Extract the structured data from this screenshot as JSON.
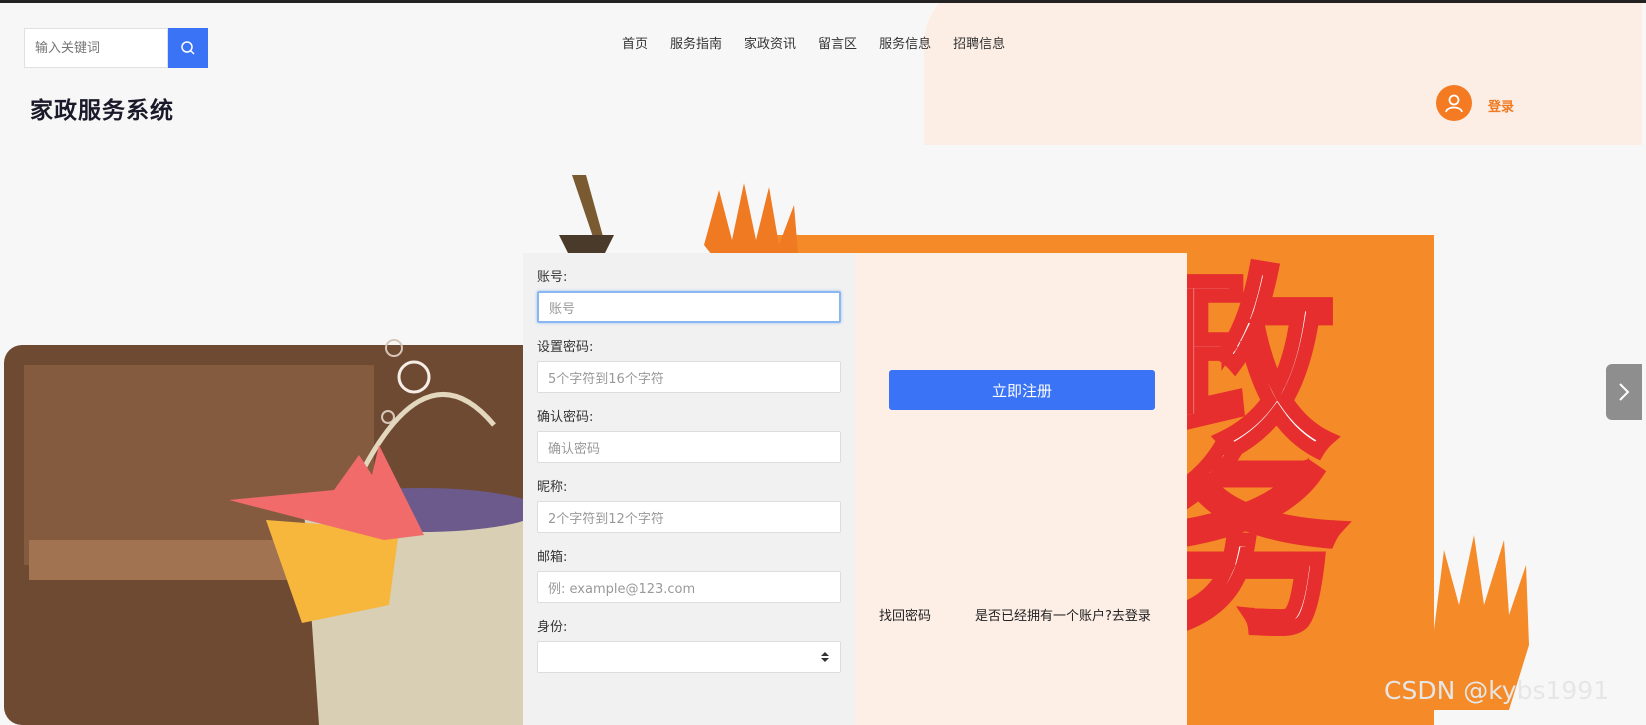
{
  "search": {
    "placeholder": "输入关键词"
  },
  "nav": {
    "items": [
      "首页",
      "服务指南",
      "家政资讯",
      "留言区",
      "服务信息",
      "招聘信息"
    ]
  },
  "brand": {
    "title": "家政服务系统"
  },
  "user": {
    "login_label": "登录"
  },
  "form": {
    "account_label": "账号:",
    "account_placeholder": "账号",
    "password_label": "设置密码:",
    "password_placeholder": "5个字符到16个字符",
    "confirm_label": "确认密码:",
    "confirm_placeholder": "确认密码",
    "nickname_label": "昵称:",
    "nickname_placeholder": "2个字符到12个字符",
    "email_label": "邮箱:",
    "email_placeholder": "例: example@123.com",
    "role_label": "身份:",
    "role_value": ""
  },
  "actions": {
    "register_label": "立即注册",
    "forgot_label": "找回密码",
    "has_account_label": "是否已经拥有一个账户?去登录"
  },
  "banner": {
    "chars": [
      "政",
      "务"
    ]
  },
  "watermark": "CSDN @kybs1991",
  "colors": {
    "primary": "#3a73f5",
    "accent": "#f47b22"
  }
}
